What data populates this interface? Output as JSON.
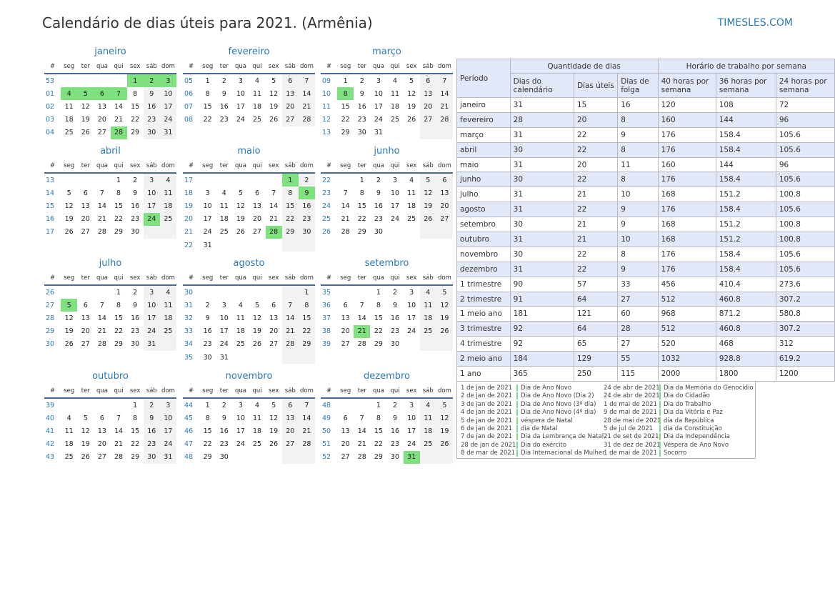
{
  "title": "Calendário de dias úteis para 2021. (Armênia)",
  "brand": "TIMESLES.COM",
  "colors": {
    "accent": "#2a7ab8",
    "holiday": "#7ee07e",
    "weekend": "#f2f2f2",
    "header_bg": "#e3e8f8"
  },
  "weekday_headers": [
    "#",
    "seg",
    "ter",
    "qua",
    "qui",
    "sex",
    "sáb",
    "dom"
  ],
  "months": [
    {
      "name": "janeiro",
      "rows": [
        [
          "53",
          "",
          "",
          "",
          "",
          "1",
          "2",
          "3"
        ],
        [
          "01",
          "4",
          "5",
          "6",
          "7",
          "8",
          "9",
          "10"
        ],
        [
          "02",
          "11",
          "12",
          "13",
          "14",
          "15",
          "16",
          "17"
        ],
        [
          "03",
          "18",
          "19",
          "20",
          "21",
          "22",
          "23",
          "24"
        ],
        [
          "04",
          "25",
          "26",
          "27",
          "28",
          "29",
          "30",
          "31"
        ]
      ],
      "holidays": [
        "1",
        "2",
        "3",
        "4",
        "5",
        "6",
        "7",
        "28"
      ]
    },
    {
      "name": "fevereiro",
      "rows": [
        [
          "05",
          "1",
          "2",
          "3",
          "4",
          "5",
          "6",
          "7"
        ],
        [
          "06",
          "8",
          "9",
          "10",
          "11",
          "12",
          "13",
          "14"
        ],
        [
          "07",
          "15",
          "16",
          "17",
          "18",
          "19",
          "20",
          "21"
        ],
        [
          "08",
          "22",
          "23",
          "24",
          "25",
          "26",
          "27",
          "28"
        ]
      ],
      "holidays": []
    },
    {
      "name": "março",
      "rows": [
        [
          "09",
          "1",
          "2",
          "3",
          "4",
          "5",
          "6",
          "7"
        ],
        [
          "10",
          "8",
          "9",
          "10",
          "11",
          "12",
          "13",
          "14"
        ],
        [
          "11",
          "15",
          "16",
          "17",
          "18",
          "19",
          "20",
          "21"
        ],
        [
          "12",
          "22",
          "23",
          "24",
          "25",
          "26",
          "27",
          "28"
        ],
        [
          "13",
          "29",
          "30",
          "31",
          "",
          "",
          "",
          ""
        ]
      ],
      "holidays": [
        "8"
      ]
    },
    {
      "name": "abril",
      "rows": [
        [
          "13",
          "",
          "",
          "",
          "1",
          "2",
          "3",
          "4"
        ],
        [
          "14",
          "5",
          "6",
          "7",
          "8",
          "9",
          "10",
          "11"
        ],
        [
          "15",
          "12",
          "13",
          "14",
          "15",
          "16",
          "17",
          "18"
        ],
        [
          "16",
          "19",
          "20",
          "21",
          "22",
          "23",
          "24",
          "25"
        ],
        [
          "17",
          "26",
          "27",
          "28",
          "29",
          "30",
          "",
          ""
        ]
      ],
      "holidays": [
        "24"
      ]
    },
    {
      "name": "maio",
      "rows": [
        [
          "17",
          "",
          "",
          "",
          "",
          "",
          "1",
          "2"
        ],
        [
          "18",
          "3",
          "4",
          "5",
          "6",
          "7",
          "8",
          "9"
        ],
        [
          "19",
          "10",
          "11",
          "12",
          "13",
          "14",
          "15",
          "16"
        ],
        [
          "20",
          "17",
          "18",
          "19",
          "20",
          "21",
          "22",
          "23"
        ],
        [
          "21",
          "24",
          "25",
          "26",
          "27",
          "28",
          "29",
          "30"
        ],
        [
          "22",
          "31",
          "",
          "",
          "",
          "",
          "",
          ""
        ]
      ],
      "holidays": [
        "1",
        "9",
        "28"
      ]
    },
    {
      "name": "junho",
      "rows": [
        [
          "22",
          "",
          "1",
          "2",
          "3",
          "4",
          "5",
          "6"
        ],
        [
          "23",
          "7",
          "8",
          "9",
          "10",
          "11",
          "12",
          "13"
        ],
        [
          "24",
          "14",
          "15",
          "16",
          "17",
          "18",
          "19",
          "20"
        ],
        [
          "25",
          "21",
          "22",
          "23",
          "24",
          "25",
          "26",
          "27"
        ],
        [
          "26",
          "28",
          "29",
          "30",
          "",
          "",
          "",
          ""
        ]
      ],
      "holidays": []
    },
    {
      "name": "julho",
      "rows": [
        [
          "26",
          "",
          "",
          "",
          "1",
          "2",
          "3",
          "4"
        ],
        [
          "27",
          "5",
          "6",
          "7",
          "8",
          "9",
          "10",
          "11"
        ],
        [
          "28",
          "12",
          "13",
          "14",
          "15",
          "16",
          "17",
          "18"
        ],
        [
          "29",
          "19",
          "20",
          "21",
          "22",
          "23",
          "24",
          "25"
        ],
        [
          "30",
          "26",
          "27",
          "28",
          "29",
          "30",
          "31",
          ""
        ]
      ],
      "holidays": [
        "5"
      ]
    },
    {
      "name": "agosto",
      "rows": [
        [
          "30",
          "",
          "",
          "",
          "",
          "",
          "",
          "1"
        ],
        [
          "31",
          "2",
          "3",
          "4",
          "5",
          "6",
          "7",
          "8"
        ],
        [
          "32",
          "9",
          "10",
          "11",
          "12",
          "13",
          "14",
          "15"
        ],
        [
          "33",
          "16",
          "17",
          "18",
          "19",
          "20",
          "21",
          "22"
        ],
        [
          "34",
          "23",
          "24",
          "25",
          "26",
          "27",
          "28",
          "29"
        ],
        [
          "35",
          "30",
          "31",
          "",
          "",
          "",
          "",
          ""
        ]
      ],
      "holidays": []
    },
    {
      "name": "setembro",
      "rows": [
        [
          "35",
          "",
          "",
          "1",
          "2",
          "3",
          "4",
          "5"
        ],
        [
          "36",
          "6",
          "7",
          "8",
          "9",
          "10",
          "11",
          "12"
        ],
        [
          "37",
          "13",
          "14",
          "15",
          "16",
          "17",
          "18",
          "19"
        ],
        [
          "38",
          "20",
          "21",
          "22",
          "23",
          "24",
          "25",
          "26"
        ],
        [
          "39",
          "27",
          "28",
          "29",
          "30",
          "",
          "",
          ""
        ]
      ],
      "holidays": [
        "21"
      ]
    },
    {
      "name": "outubro",
      "rows": [
        [
          "39",
          "",
          "",
          "",
          "",
          "1",
          "2",
          "3"
        ],
        [
          "40",
          "4",
          "5",
          "6",
          "7",
          "8",
          "9",
          "10"
        ],
        [
          "41",
          "11",
          "12",
          "13",
          "14",
          "15",
          "16",
          "17"
        ],
        [
          "42",
          "18",
          "19",
          "20",
          "21",
          "22",
          "23",
          "24"
        ],
        [
          "43",
          "25",
          "26",
          "27",
          "28",
          "29",
          "30",
          "31"
        ]
      ],
      "holidays": []
    },
    {
      "name": "novembro",
      "rows": [
        [
          "44",
          "1",
          "2",
          "3",
          "4",
          "5",
          "6",
          "7"
        ],
        [
          "45",
          "8",
          "9",
          "10",
          "11",
          "12",
          "13",
          "14"
        ],
        [
          "46",
          "15",
          "16",
          "17",
          "18",
          "19",
          "20",
          "21"
        ],
        [
          "47",
          "22",
          "23",
          "24",
          "25",
          "26",
          "27",
          "28"
        ],
        [
          "48",
          "29",
          "30",
          "",
          "",
          "",
          "",
          ""
        ]
      ],
      "holidays": []
    },
    {
      "name": "dezembro",
      "rows": [
        [
          "48",
          "",
          "",
          "1",
          "2",
          "3",
          "4",
          "5"
        ],
        [
          "49",
          "6",
          "7",
          "8",
          "9",
          "10",
          "11",
          "12"
        ],
        [
          "50",
          "13",
          "14",
          "15",
          "16",
          "17",
          "18",
          "19"
        ],
        [
          "51",
          "20",
          "21",
          "22",
          "23",
          "24",
          "25",
          "26"
        ],
        [
          "52",
          "27",
          "28",
          "29",
          "30",
          "31",
          "",
          ""
        ]
      ],
      "holidays": [
        "31"
      ]
    }
  ],
  "summary": {
    "period_header": "Período",
    "group1": "Quantidade de dias",
    "group2": "Horário de trabalho por semana",
    "cols": [
      "Dias do calendário",
      "Dias úteis",
      "Dias de folga",
      "40 horas por semana",
      "36 horas por semana",
      "24 horas por semana"
    ],
    "rows": [
      [
        "janeiro",
        "31",
        "15",
        "16",
        "120",
        "108",
        "72"
      ],
      [
        "fevereiro",
        "28",
        "20",
        "8",
        "160",
        "144",
        "96"
      ],
      [
        "março",
        "31",
        "22",
        "9",
        "176",
        "158.4",
        "105.6"
      ],
      [
        "abril",
        "30",
        "22",
        "8",
        "176",
        "158.4",
        "105.6"
      ],
      [
        "maio",
        "31",
        "20",
        "11",
        "160",
        "144",
        "96"
      ],
      [
        "junho",
        "30",
        "22",
        "8",
        "176",
        "158.4",
        "105.6"
      ],
      [
        "julho",
        "31",
        "21",
        "10",
        "168",
        "151.2",
        "100.8"
      ],
      [
        "agosto",
        "31",
        "22",
        "9",
        "176",
        "158.4",
        "105.6"
      ],
      [
        "setembro",
        "30",
        "21",
        "9",
        "168",
        "151.2",
        "100.8"
      ],
      [
        "outubro",
        "31",
        "21",
        "10",
        "168",
        "151.2",
        "100.8"
      ],
      [
        "novembro",
        "30",
        "22",
        "8",
        "176",
        "158.4",
        "105.6"
      ],
      [
        "dezembro",
        "31",
        "22",
        "9",
        "176",
        "158.4",
        "105.6"
      ],
      [
        "1 trimestre",
        "90",
        "57",
        "33",
        "456",
        "410.4",
        "273.6"
      ],
      [
        "2 trimestre",
        "91",
        "64",
        "27",
        "512",
        "460.8",
        "307.2"
      ],
      [
        "1 meio ano",
        "181",
        "121",
        "60",
        "968",
        "871.2",
        "580.8"
      ],
      [
        "3 trimestre",
        "92",
        "64",
        "28",
        "512",
        "460.8",
        "307.2"
      ],
      [
        "4 trimestre",
        "92",
        "65",
        "27",
        "520",
        "468",
        "312"
      ],
      [
        "2 meio ano",
        "184",
        "129",
        "55",
        "1032",
        "928.8",
        "619.2"
      ],
      [
        "1 ano",
        "365",
        "250",
        "115",
        "2000",
        "1800",
        "1200"
      ]
    ]
  },
  "holiday_list": {
    "left": [
      {
        "date": "1 de jan de 2021",
        "name": "Dia de Ano Novo"
      },
      {
        "date": "2 de jan de 2021",
        "name": "Dia de Ano Novo (Dia 2)"
      },
      {
        "date": "3 de jan de 2021",
        "name": "Dia de Ano Novo (3º dia)"
      },
      {
        "date": "4 de jan de 2021",
        "name": "Dia de Ano Novo (4º dia)"
      },
      {
        "date": "5 de jan de 2021",
        "name": "véspera de Natal"
      },
      {
        "date": "6 de jan de 2021",
        "name": "dia de Natal"
      },
      {
        "date": "7 de jan de 2021",
        "name": "Dia da Lembrança de Natal"
      },
      {
        "date": "28 de jan de 2021",
        "name": "Dia do exército"
      },
      {
        "date": "8 de mar de 2021",
        "name": "Dia Internacional da Mulher"
      }
    ],
    "right": [
      {
        "date": "24 de abr de 2021",
        "name": "Dia da Memória do Genocídio"
      },
      {
        "date": "24 de abr de 2021",
        "name": "Dia do Cidadão"
      },
      {
        "date": "1 de mai de 2021",
        "name": "Dia do Trabalho"
      },
      {
        "date": "9 de mai de 2021",
        "name": "Dia da Vitória e Paz"
      },
      {
        "date": "28 de mai de 2021",
        "name": "dia da República"
      },
      {
        "date": "5 de jul de 2021",
        "name": "dia da Constituição"
      },
      {
        "date": "21 de set de 2021",
        "name": "Dia da Independência"
      },
      {
        "date": "31 de dez de 2021",
        "name": "Véspera de Ano Novo"
      },
      {
        "date": "1 de mai de 2021",
        "name": "Socorro"
      }
    ]
  }
}
